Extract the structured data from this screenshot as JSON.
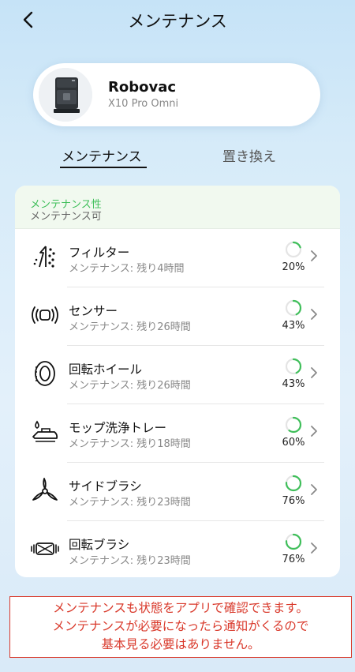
{
  "header": {
    "title": "メンテナンス",
    "back_icon": "chevron-left-icon"
  },
  "device": {
    "name": "Robovac",
    "model": "X10 Pro Omni"
  },
  "tabs": [
    {
      "label": "メンテナンス",
      "active": true
    },
    {
      "label": "置き換え",
      "active": false
    }
  ],
  "panel": {
    "status_title": "メンテナンス性",
    "status_sub": "メンテナンス可",
    "items": [
      {
        "icon": "filter-icon",
        "name": "フィルター",
        "remaining": "メンテナンス: 残り4時間",
        "percent_label": "20%",
        "percent": 20
      },
      {
        "icon": "sensor-icon",
        "name": "センサー",
        "remaining": "メンテナンス: 残り26時間",
        "percent_label": "43%",
        "percent": 43
      },
      {
        "icon": "wheel-icon",
        "name": "回転ホイール",
        "remaining": "メンテナンス: 残り26時間",
        "percent_label": "43%",
        "percent": 43
      },
      {
        "icon": "mop-tray-icon",
        "name": "モップ洗浄トレー",
        "remaining": "メンテナンス: 残り18時間",
        "percent_label": "60%",
        "percent": 60
      },
      {
        "icon": "side-brush-icon",
        "name": "サイドブラシ",
        "remaining": "メンテナンス: 残り23時間",
        "percent_label": "76%",
        "percent": 76
      },
      {
        "icon": "roller-brush-icon",
        "name": "回転ブラシ",
        "remaining": "メンテナンス: 残り23時間",
        "percent_label": "76%",
        "percent": 76
      }
    ]
  },
  "note": {
    "lines": [
      "メンテナンスも状態をアプリで確認できます。",
      "メンテナンスが必要になったら通知がくるので",
      "基本見る必要はありません。"
    ]
  },
  "colors": {
    "accent_green": "#3fbf5a",
    "note_red": "#d9392b",
    "ring_track": "#e4e4e4"
  }
}
